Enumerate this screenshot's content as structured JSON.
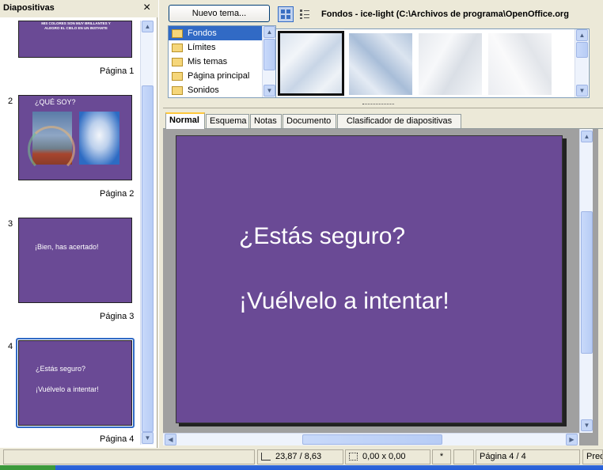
{
  "slides_pane": {
    "title": "Diapositivas",
    "close_glyph": "×",
    "slide1": {
      "text": "MIS COLORES SON MUY BRILLANTES Y ALEGRO EL CIELO EN UN INSTANTE",
      "label": "Página 1"
    },
    "slide2": {
      "number": "2",
      "title": "¿QUÉ SOY?",
      "label": "Página 2"
    },
    "slide3": {
      "number": "3",
      "text": "¡Bien, has acertado!",
      "label": "Página 3"
    },
    "slide4": {
      "number": "4",
      "line1": "¿Estás seguro?",
      "line2": "¡Vuélvelo a intentar!",
      "label": "Página 4"
    }
  },
  "gallery": {
    "new_theme_button": "Nuevo tema...",
    "title": "Fondos - ice-light (C:\\Archivos de programa\\OpenOffice.org",
    "themes": [
      {
        "label": "Fondos",
        "selected": true
      },
      {
        "label": "Límites",
        "selected": false
      },
      {
        "label": "Mis temas",
        "selected": false
      },
      {
        "label": "Página principal",
        "selected": false
      },
      {
        "label": "Sonidos",
        "selected": false
      }
    ]
  },
  "view_tabs": {
    "normal": "Normal",
    "outline": "Esquema",
    "notes": "Notas",
    "handout": "Documento",
    "sorter": "Clasificador de diapositivas"
  },
  "main_slide": {
    "line1": "¿Estás seguro?",
    "line2": "¡Vuélvelo a intentar!",
    "background_color": "#6A4A95"
  },
  "status_bar": {
    "position": "23,87 / 8,63",
    "size": "0,00 x 0,00",
    "modified": "*",
    "page": "Página 4 / 4",
    "style": "Pred"
  }
}
